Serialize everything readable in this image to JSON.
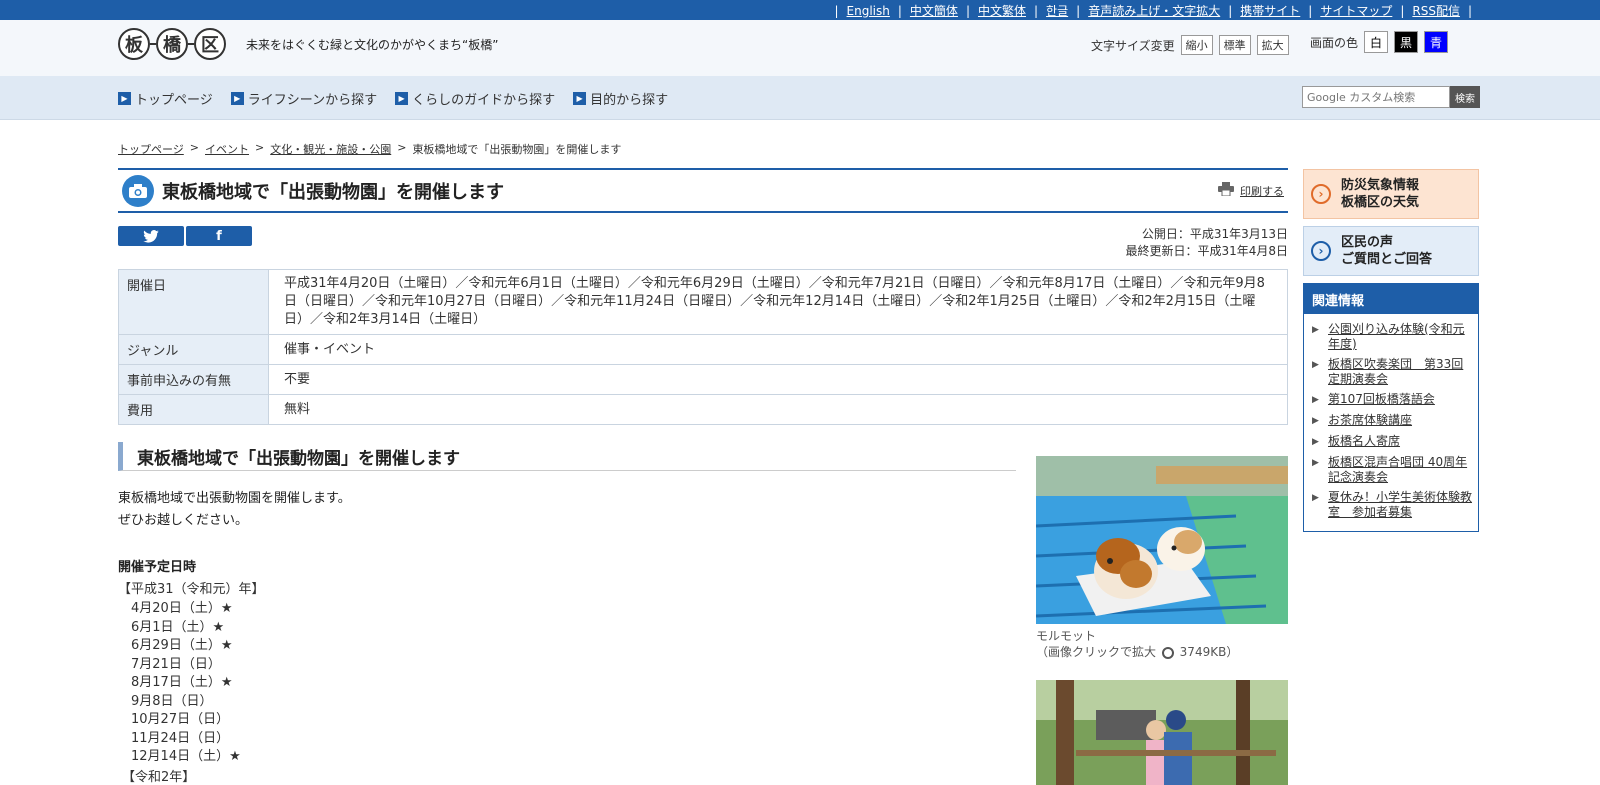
{
  "top_links": [
    "English",
    "中文簡体",
    "中文繁体",
    "한글",
    "音声読み上げ・文字拡大",
    "携帯サイト",
    "サイトマップ",
    "RSS配信"
  ],
  "logo": {
    "chars": [
      "板",
      "橋",
      "区"
    ]
  },
  "tagline": "未来をはぐくむ緑と文化のかがやくまち“板橋”",
  "fontsize": {
    "label": "文字サイズ変更",
    "buttons": [
      "縮小",
      "標準",
      "拡大"
    ]
  },
  "screen_color": {
    "label": "画面の色",
    "options": [
      "白",
      "黒",
      "青"
    ]
  },
  "nav": [
    "トップページ",
    "ライフシーンから探す",
    "くらしのガイドから探す",
    "目的から探す"
  ],
  "search": {
    "placeholder": "Google カスタム検索",
    "button": "検索"
  },
  "breadcrumb": [
    "トップページ",
    "イベント",
    "文化・観光・施設・公園",
    "東板橋地域で「出張動物園」を開催します"
  ],
  "page_title": "東板橋地域で「出張動物園」を開催します",
  "print_label": "印刷する",
  "published": "公開日：平成31年3月13日",
  "updated": "最終更新日：平成31年4月8日",
  "info_table": [
    {
      "label": "開催日",
      "value": "平成31年4月20日（土曜日）／令和元年6月1日（土曜日）／令和元年6月29日（土曜日）／令和元年7月21日（日曜日）／令和元年8月17日（土曜日）／令和元年9月8日（日曜日）／令和元年10月27日（日曜日）／令和元年11月24日（日曜日）／令和元年12月14日（土曜日）／令和2年1月25日（土曜日）／令和2年2月15日（土曜日）／令和2年3月14日（土曜日）"
    },
    {
      "label": "ジャンル",
      "value": "催事・イベント"
    },
    {
      "label": "事前申込みの有無",
      "value": "不要"
    },
    {
      "label": "費用",
      "value": "無料"
    }
  ],
  "section_heading": "東板橋地域で「出張動物園」を開催します",
  "body": [
    "東板橋地域で出張動物園を開催します。",
    "ぜひお越しください。"
  ],
  "schedule": {
    "heading": "開催予定日時",
    "year1": "【平成31（令和元）年】",
    "dates": [
      "4月20日（土）★",
      "6月1日（土）★",
      "6月29日（土）★",
      "7月21日（日）",
      "8月17日（土）★",
      "9月8日（日）",
      "10月27日（日）",
      "11月24日（日）",
      "12月14日（土）★"
    ],
    "year2": "【令和2年】"
  },
  "photo_caption": {
    "name": "モルモット",
    "zoom_text_before": "（画像クリックで拡大",
    "zoom_text_after": "3749KB）"
  },
  "sidebar": {
    "bousai": [
      "防災気象情報",
      "板橋区の天気"
    ],
    "kumin": [
      "区民の声",
      "ご質問とご回答"
    ],
    "related_heading": "関連情報",
    "related": [
      "公園刈り込み体験(令和元年度)",
      "板橋区吹奏楽団　第33回定期演奏会",
      "第107回板橋落語会",
      "お茶席体験講座",
      "板橋名人寄席",
      "板橋区混声合唱団 40周年記念演奏会",
      "夏休み！小学生美術体験教室　参加者募集"
    ]
  },
  "colors": {
    "brand_blue": "#1e5ea8",
    "bousai_bg": "#fde4d2",
    "bousai_accent": "#e06b2a"
  }
}
